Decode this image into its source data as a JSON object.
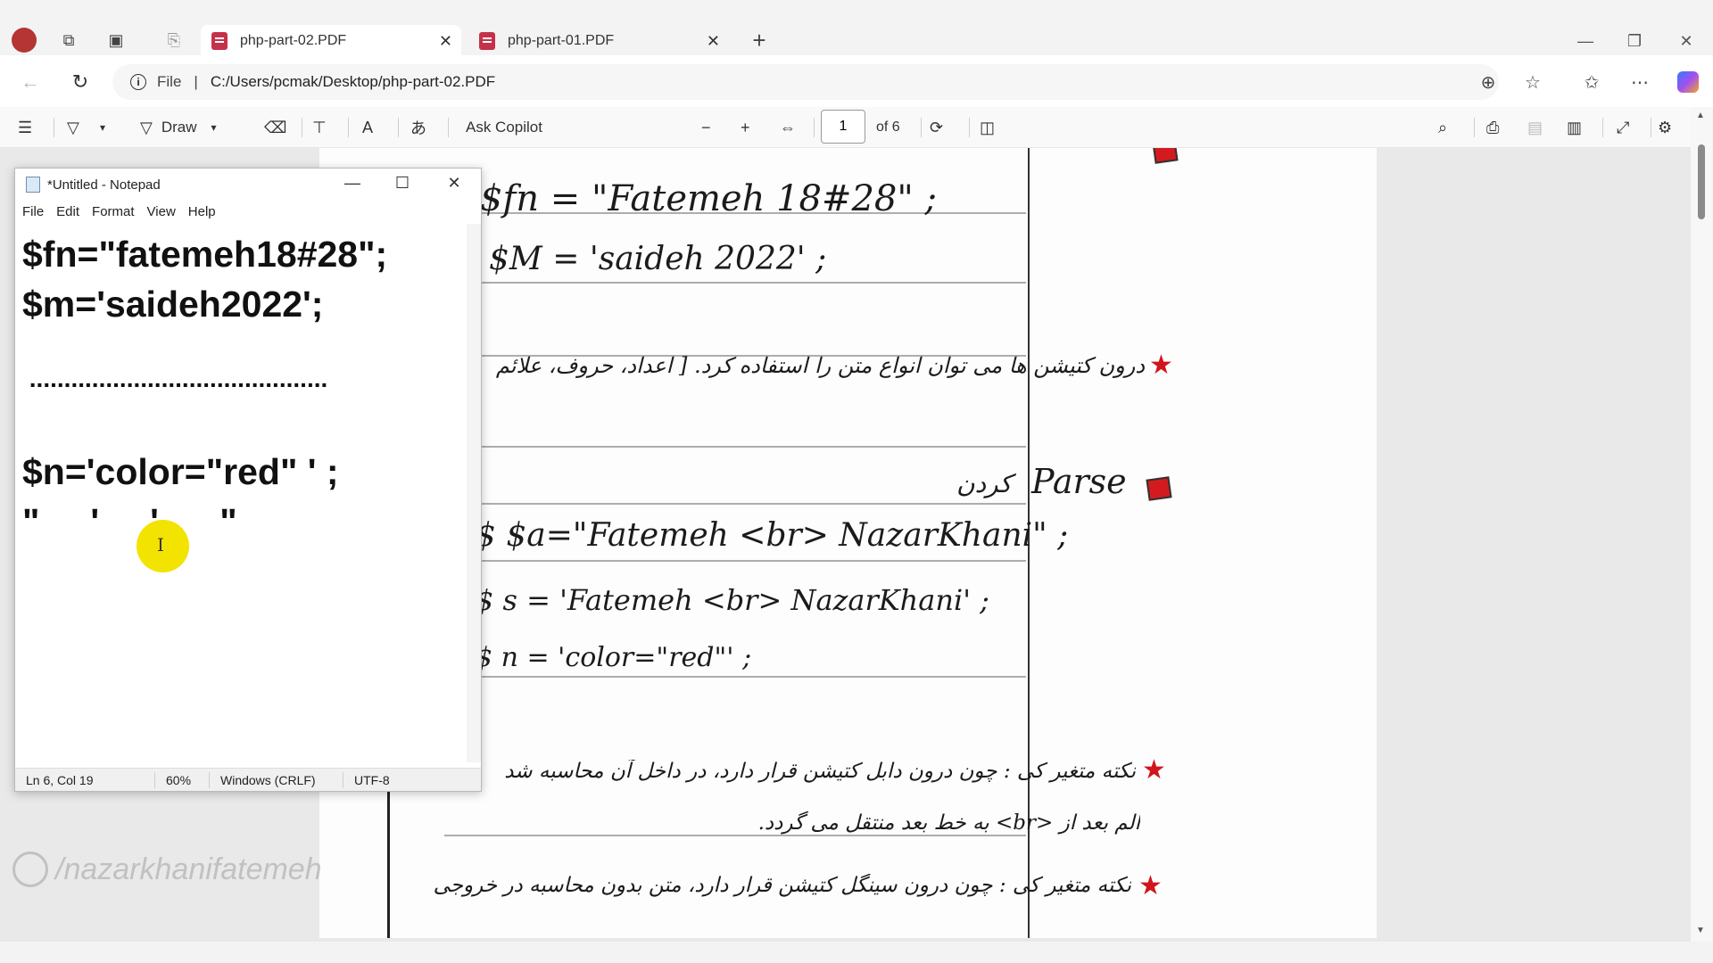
{
  "browser": {
    "tabs": [
      {
        "title": "php-part-02.PDF",
        "active": true
      },
      {
        "title": "php-part-01.PDF",
        "active": false
      }
    ],
    "address": {
      "prefix": "File",
      "url": "C:/Users/pcmak/Desktop/php-part-02.PDF"
    }
  },
  "pdf_toolbar": {
    "draw_label": "Draw",
    "ask_copilot_label": "Ask Copilot",
    "page_current": "1",
    "page_total": "of 6"
  },
  "notepad": {
    "title": "*Untitled - Notepad",
    "menu": [
      "File",
      "Edit",
      "Format",
      "View",
      "Help"
    ],
    "lines": [
      "$fn=\"fatemeh18#28\";",
      "$m='saideh2022';",
      "",
      " ...........................................",
      "",
      "$n='color=\"red\" ' ;",
      "\"     '     '      \""
    ],
    "status": {
      "position": "Ln 6, Col 19",
      "zoom": "60%",
      "line_ending": "Windows (CRLF)",
      "encoding": "UTF-8"
    }
  },
  "handwriting": {
    "line1": "$fn = \"Fatemeh 18#28\" ;",
    "line2": "$M = 'saideh 2022' ;",
    "line3": "درون کتیشن ها می توان انواع متن را استفاده کرد. [ اعداد، حروف، علائم",
    "line4_word": "Parse",
    "line4_fa": "کردن",
    "line5": "$ $a=\"Fatemeh <br> NazarKhani\" ;",
    "line6": "$ s = 'Fatemeh <br> NazarKhani' ;",
    "line7": "$ n = 'color=\"red\"' ;",
    "line8": "نکته متغیر کی : چون درون دابل کتیشن قرار دارد، در داخل آن محاسبه شد",
    "line9": "الم بعد از <br> به خط بعد منتقل می گردد.",
    "line10": "نکته متغیر کی : چون درون سینگل کتیشن قرار دارد، متن بدون محاسبه در خروجی"
  },
  "watermark": {
    "text": "/nazarkhanifatemeh"
  },
  "colors": {
    "accent_red": "#d0161c",
    "cursor_highlight": "#f2e300"
  }
}
